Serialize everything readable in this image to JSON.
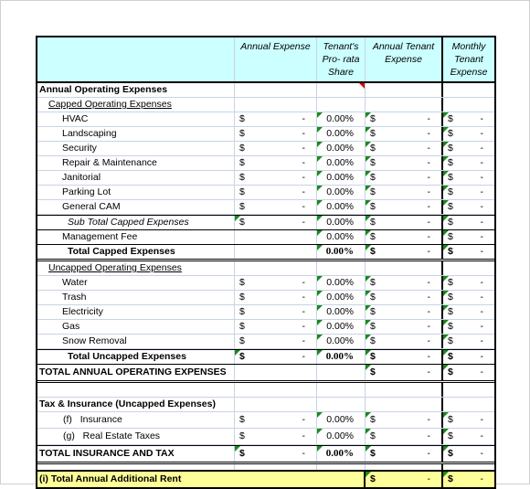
{
  "header": {
    "col1": "Annual Expense",
    "col2_line1": "Tenant's",
    "col2_line2": "Pro- rata",
    "col2_line3": "Share",
    "col3_line1": "Annual Tenant",
    "col3_line2": "Expense",
    "col4_line1": "Monthly",
    "col4_line2": "Tenant",
    "col4_line3": "Expense"
  },
  "symbols": {
    "currency": "$",
    "dash": "-",
    "zero_pct": "0.00%"
  },
  "sections": {
    "annual_operating": "Annual Operating Expenses",
    "capped": "Capped Operating Expenses",
    "uncapped": "Uncapped Operating Expenses ",
    "tax_insurance": "Tax & Insurance (Uncapped Expenses)"
  },
  "capped_items": [
    "HVAC",
    "Landscaping",
    "Security",
    "Repair & Maintenance",
    "Janitorial",
    "Parking Lot",
    "General CAM"
  ],
  "subtotal_capped": "Sub Total Capped Expenses",
  "management_fee": "Management Fee",
  "total_capped": "Total Capped Expenses",
  "uncapped_items": [
    "Water",
    "Trash",
    "Electricity",
    "Gas",
    "Snow Removal"
  ],
  "total_uncapped": "Total Uncapped Expenses",
  "total_annual_operating": "TOTAL ANNUAL OPERATING EXPENSES",
  "tax_items": [
    {
      "code": "(f)",
      "label": "Insurance"
    },
    {
      "code": "(g)",
      "label": "Real Estate Taxes"
    }
  ],
  "total_insurance_tax": "TOTAL INSURANCE AND TAX",
  "total_additional_rent": "(i) Total Annual Additional Rent",
  "colors": {
    "header_bg": "#ccffff",
    "total_bg": "#ffff99",
    "comment_marker": "#e00000",
    "formula_marker": "#1a8a1a"
  }
}
